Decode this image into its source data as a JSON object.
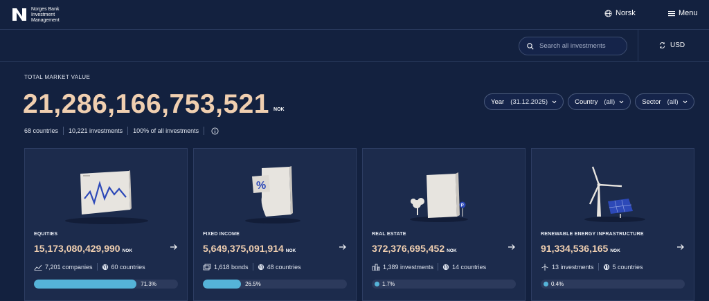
{
  "header": {
    "logo_text": "Norges Bank Investment Management",
    "language_label": "Norsk",
    "menu_label": "Menu"
  },
  "toolbar": {
    "search_placeholder": "Search all investments",
    "currency_label": "USD"
  },
  "summary": {
    "label": "TOTAL MARKET VALUE",
    "value": "21,286,166,753,521",
    "unit": "NOK",
    "countries": "68 countries",
    "investments": "10,221 investments",
    "share": "100% of all investments"
  },
  "filters": [
    {
      "label": "Year",
      "value": "(31.12.2025)"
    },
    {
      "label": "Country",
      "value": "(all)"
    },
    {
      "label": "Sector",
      "value": "(all)"
    }
  ],
  "cards": [
    {
      "title": "EQUITIES",
      "value": "15,173,080,429,990",
      "unit": "NOK",
      "count": "7,201 companies",
      "countries": "60 countries",
      "share_label": "71.3%",
      "share": 71.3,
      "count_icon": "chart-icon"
    },
    {
      "title": "FIXED INCOME",
      "value": "5,649,375,091,914",
      "unit": "NOK",
      "count": "1,618 bonds",
      "countries": "48 countries",
      "share_label": "26.5%",
      "share": 26.5,
      "count_icon": "bonds-icon"
    },
    {
      "title": "REAL ESTATE",
      "value": "372,376,695,452",
      "unit": "NOK",
      "count": "1,389 investments",
      "countries": "14 countries",
      "share_label": "1.7%",
      "share": 1.7,
      "count_icon": "building-icon"
    },
    {
      "title": "RENEWABLE ENERGY INFRASTRUCTURE",
      "value": "91,334,536,165",
      "unit": "NOK",
      "count": "13 investments",
      "countries": "5 countries",
      "share_label": "0.4%",
      "share": 0.4,
      "count_icon": "turbine-icon"
    }
  ],
  "colors": {
    "accent": "#f0cfb0",
    "bar": "#55b3d8",
    "background": "#13213f",
    "card": "#1c2b4c"
  }
}
